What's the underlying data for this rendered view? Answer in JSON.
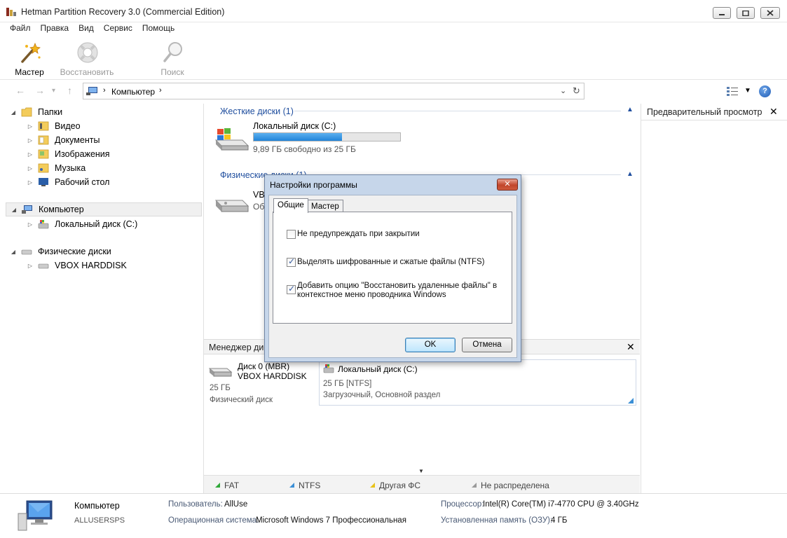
{
  "window": {
    "title": "Hetman Partition Recovery 3.0 (Commercial Edition)"
  },
  "menu": [
    "Файл",
    "Правка",
    "Вид",
    "Сервис",
    "Помощь"
  ],
  "toolbar": {
    "wizard": "Мастер",
    "restore": "Восстановить",
    "search": "Поиск"
  },
  "address": {
    "crumb": "Компьютер"
  },
  "tree": {
    "folders": "Папки",
    "video": "Видео",
    "documents": "Документы",
    "images": "Изображения",
    "music": "Музыка",
    "desktop": "Рабочий стол",
    "computer": "Компьютер",
    "local_disk": "Локальный диск (C:)",
    "physical": "Физические диски",
    "vbox": "VBOX HARDDISK"
  },
  "center": {
    "hard_disks": "Жесткие диски (1)",
    "disk_name": "Локальный диск (C:)",
    "disk_usage_fraction": 0.605,
    "disk_free": "9,89 ГБ свободно из 25 ГБ",
    "physical_disks": "Физические диски (1)",
    "vbox_partial": "VBO",
    "ob_partial": "Об"
  },
  "preview": {
    "title": "Предварительный просмотр"
  },
  "dialog": {
    "title": "Настройки программы",
    "tab_general": "Общие",
    "tab_wizard": "Мастер",
    "opt1": "Не предупреждать при закрытии",
    "opt1_checked": false,
    "opt2": "Выделять шифрованные и сжатые файлы (NTFS)",
    "opt2_checked": true,
    "opt3_line1": "Добавить опцию \"Восстановить удаленные файлы\" в",
    "opt3_line2": "контекстное меню проводника Windows",
    "opt3_checked": true,
    "ok": "OK",
    "cancel": "Отмена"
  },
  "disk_manager": {
    "title": "Менеджер дис",
    "disk_label": "Диск 0 (MBR)",
    "disk_model": "VBOX HARDDISK",
    "disk_size": "25 ГБ",
    "disk_type": "Физический диск",
    "part_name": "Локальный диск (C:)",
    "part_fs": "25 ГБ [NTFS]",
    "part_desc": "Загрузочный, Основной раздел"
  },
  "legend": {
    "fat": "FAT",
    "ntfs": "NTFS",
    "other": "Другая ФС",
    "unalloc": "Не распределена"
  },
  "colors": {
    "fat": "#2fa838",
    "ntfs": "#3b8fd6",
    "other": "#e8c21a",
    "unalloc": "#9a9a9a",
    "accent": "#1f4e9e",
    "progress": "#2d8fe0"
  },
  "status": {
    "name": "Компьютер",
    "user_label": "ALLUSERSPS",
    "k_user": "Пользователь:",
    "v_user": "AllUse",
    "k_os": "Операционная система:",
    "v_os": "Microsoft Windows 7 Профессиональная",
    "k_cpu": "Процессор:",
    "v_cpu": "Intel(R) Core(TM) i7-4770 CPU @ 3.40GHz",
    "k_mem": "Установленная память (ОЗУ):",
    "v_mem": "4 ГБ"
  }
}
